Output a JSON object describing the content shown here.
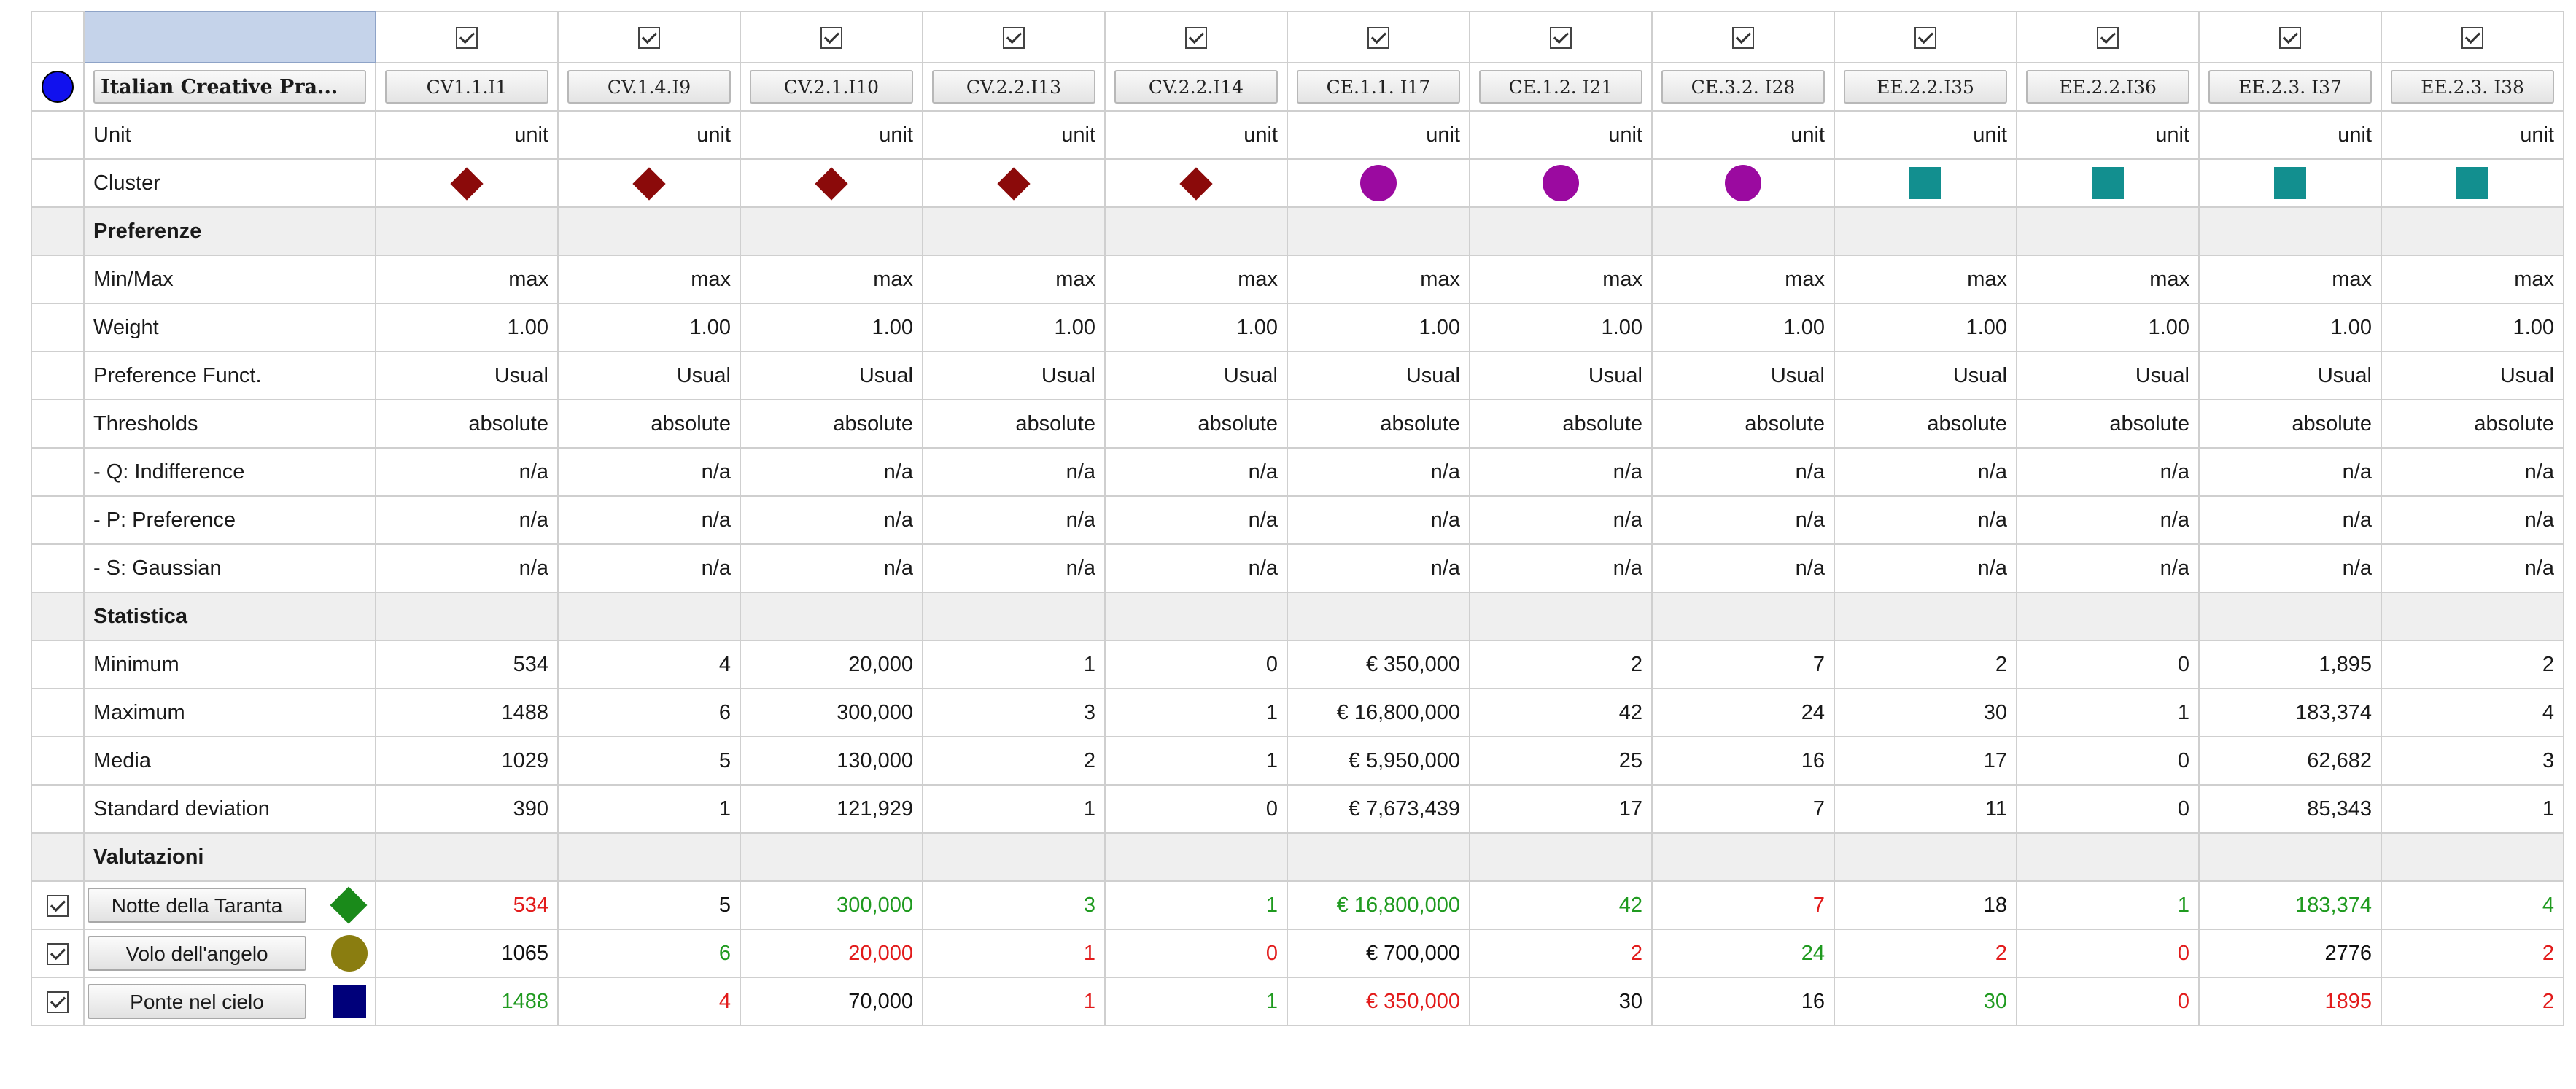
{
  "title": "Italian Creative Pra...",
  "criteria": [
    "CV1.1.I1",
    "CV.1.4.I9",
    "CV.2.1.I10",
    "CV.2.2.I13",
    "CV.2.2.I14",
    "CE.1.1. I17",
    "CE.1.2. I21",
    "CE.3.2. I28",
    "EE.2.2.I35",
    "EE.2.2.I36",
    "EE.2.3. I37",
    "EE.2.3. I38"
  ],
  "clusters": [
    "diamond",
    "diamond",
    "diamond",
    "diamond",
    "diamond",
    "circle",
    "circle",
    "circle",
    "square",
    "square",
    "square",
    "square"
  ],
  "colors": {
    "diamond": "#8b0a0a",
    "circle": "#9b0aa0",
    "square": "#128f8f",
    "positive": "#1f9a1f",
    "negative": "#e21b1b",
    "selected": "#c5d3ea"
  },
  "rows": {
    "unit": {
      "label": "Unit",
      "value": "unit"
    },
    "cluster": {
      "label": "Cluster"
    },
    "preferenze": {
      "label": "Preferenze"
    },
    "minmax": {
      "label": "Min/Max",
      "value": "max"
    },
    "weight": {
      "label": "Weight",
      "value": "1.00"
    },
    "preffunct": {
      "label": "Preference Funct.",
      "value": "Usual"
    },
    "thresholds": {
      "label": "Thresholds",
      "value": "absolute"
    },
    "q": {
      "label": "- Q: Indifference",
      "value": "n/a"
    },
    "p": {
      "label": "- P: Preference",
      "value": "n/a"
    },
    "s": {
      "label": "- S: Gaussian",
      "value": "n/a"
    },
    "statistica": {
      "label": "Statistica"
    },
    "minimum": {
      "label": "Minimum",
      "values": [
        "534",
        "4",
        "20,000",
        "1",
        "0",
        "€ 350,000",
        "2",
        "7",
        "2",
        "0",
        "1,895",
        "2"
      ]
    },
    "maximum": {
      "label": "Maximum",
      "values": [
        "1488",
        "6",
        "300,000",
        "3",
        "1",
        "€ 16,800,000",
        "42",
        "24",
        "30",
        "1",
        "183,374",
        "4"
      ]
    },
    "media": {
      "label": "Media",
      "values": [
        "1029",
        "5",
        "130,000",
        "2",
        "1",
        "€ 5,950,000",
        "25",
        "16",
        "17",
        "0",
        "62,682",
        "3"
      ]
    },
    "stddev": {
      "label": "Standard deviation",
      "values": [
        "390",
        "1",
        "121,929",
        "1",
        "0",
        "€ 7,673,439",
        "17",
        "7",
        "11",
        "0",
        "85,343",
        "1"
      ]
    },
    "valutazioni": {
      "label": "Valutazioni"
    }
  },
  "alternatives": [
    {
      "name": "Notte della Taranta",
      "symbol": "diamond",
      "values": [
        "534",
        "5",
        "300,000",
        "3",
        "1",
        "€ 16,800,000",
        "42",
        "7",
        "18",
        "1",
        "183,374",
        "4"
      ],
      "tones": [
        "r",
        "k",
        "g",
        "g",
        "g",
        "g",
        "g",
        "r",
        "k",
        "g",
        "g",
        "g"
      ]
    },
    {
      "name": "Volo dell'angelo",
      "symbol": "circle",
      "values": [
        "1065",
        "6",
        "20,000",
        "1",
        "0",
        "€ 700,000",
        "2",
        "24",
        "2",
        "0",
        "2776",
        "2"
      ],
      "tones": [
        "k",
        "g",
        "r",
        "r",
        "r",
        "k",
        "r",
        "g",
        "r",
        "r",
        "k",
        "r"
      ]
    },
    {
      "name": "Ponte nel cielo",
      "symbol": "square",
      "values": [
        "1488",
        "4",
        "70,000",
        "1",
        "1",
        "€ 350,000",
        "30",
        "16",
        "30",
        "0",
        "1895",
        "2"
      ],
      "tones": [
        "g",
        "r",
        "k",
        "r",
        "g",
        "r",
        "k",
        "k",
        "g",
        "r",
        "r",
        "r"
      ]
    }
  ]
}
